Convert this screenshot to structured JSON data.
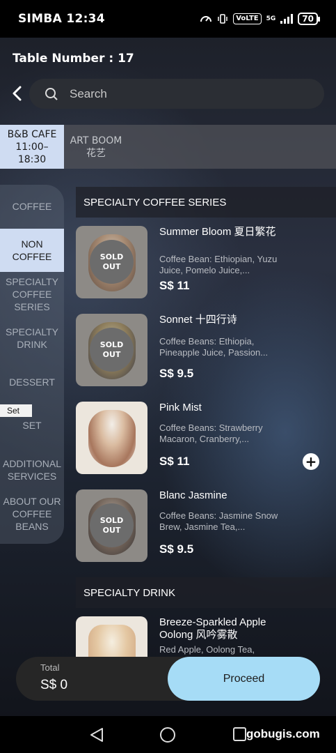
{
  "status_bar": {
    "left": "SIMBA 12:34",
    "chip_volte": "VoLTE",
    "chip_5g": "5G",
    "battery": "70"
  },
  "header": {
    "table_number": "Table Number : 17",
    "search_placeholder": "Search"
  },
  "stores": [
    {
      "name": "B&B CAFE",
      "hours": "11:00–18:30",
      "active": true
    },
    {
      "name": "ART BOOM",
      "sub": "花艺",
      "active": false
    }
  ],
  "categories": [
    {
      "label": "COFFEE"
    },
    {
      "label": "NON COFFEE",
      "active": true
    },
    {
      "label": "SPECIALTY COFFEE SERIES"
    },
    {
      "label": "SPECIALTY DRINK"
    },
    {
      "label": "DESSERT"
    },
    {
      "label": "SET",
      "tag": "Set"
    },
    {
      "label": "ADDITIONAL SERVICES"
    },
    {
      "label": "ABOUT OUR COFFEE BEANS"
    }
  ],
  "sections": [
    {
      "title": "SPECIALTY COFFEE SERIES",
      "items": [
        {
          "name": "Summer Bloom 夏日繁花",
          "desc": "Coffee Bean: Ethiopian, Yuzu Juice, Pomelo Juice,...",
          "price": "S$ 11",
          "sold_out": "SOLD OUT"
        },
        {
          "name": "Sonnet 十四行诗",
          "desc": "Coffee Beans: Ethiopia, Pineapple Juice, Passion...",
          "price": "S$ 9.5",
          "sold_out": "SOLD OUT"
        },
        {
          "name": "Pink Mist",
          "desc": "Coffee Beans: Strawberry Macaron, Cranberry,...",
          "price": "S$ 11",
          "add": "+"
        },
        {
          "name": "Blanc Jasmine",
          "desc": "Coffee Beans: Jasmine Snow Brew, Jasmine Tea,...",
          "price": "S$ 9.5",
          "sold_out": "SOLD OUT"
        }
      ]
    },
    {
      "title": "SPECIALTY DRINK",
      "items": [
        {
          "name": "Breeze-Sparkled Apple Oolong 风吟雾散",
          "desc": "Red Apple, Oolong Tea,"
        }
      ]
    }
  ],
  "cart": {
    "total_label": "Total",
    "total_value": "S$ 0",
    "proceed_label": "Proceed"
  },
  "watermark": "gobugis.com"
}
